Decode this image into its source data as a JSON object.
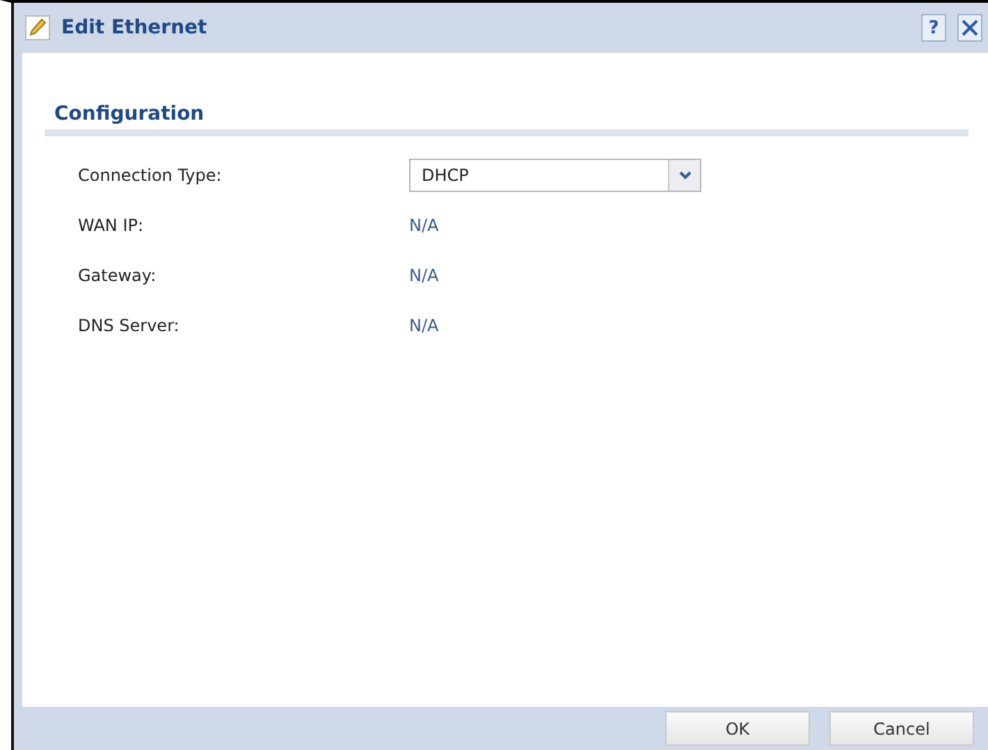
{
  "window": {
    "title": "Edit Ethernet",
    "help": "?"
  },
  "section": {
    "title": "Configuration"
  },
  "fields": [
    {
      "kind": "select",
      "label": "Connection Type:",
      "value": "DHCP"
    },
    {
      "kind": "text",
      "label": "WAN IP:",
      "value": "N/A"
    },
    {
      "kind": "text",
      "label": "Gateway:",
      "value": "N/A"
    },
    {
      "kind": "text",
      "label": "DNS Server:",
      "value": "N/A"
    }
  ],
  "buttons": [
    "OK",
    "Cancel"
  ]
}
